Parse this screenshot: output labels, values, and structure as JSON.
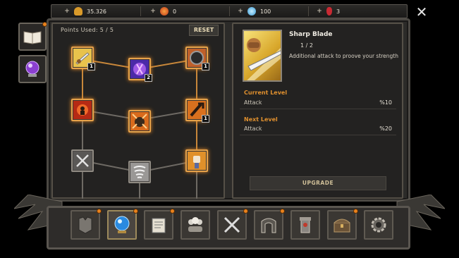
{
  "resources": [
    {
      "plus": "+",
      "value": "35.326",
      "icon": "gold-bag-icon",
      "color": "#e4a330"
    },
    {
      "plus": "+",
      "value": "0",
      "icon": "fire-orb-icon",
      "color": "#e4602a"
    },
    {
      "plus": "+",
      "value": "100",
      "icon": "blue-gem-icon",
      "color": "#6ec0e6"
    },
    {
      "plus": "+",
      "value": "3",
      "icon": "red-potion-icon",
      "color": "#d6343a"
    }
  ],
  "close_label": "✕",
  "side_tabs": [
    {
      "icon": "book-icon",
      "badge": true
    },
    {
      "icon": "crystal-ball-icon",
      "badge": false
    }
  ],
  "tree": {
    "points_label": "Points Used:",
    "points_value": "5 / 5",
    "reset_label": "RESET",
    "nodes": [
      {
        "icon": "sharp-blade-icon",
        "level": "1",
        "state": "active"
      },
      {
        "icon": "purple-aura-icon",
        "level": "2",
        "state": "active"
      },
      {
        "icon": "shield-icon",
        "level": "1",
        "state": "active"
      },
      {
        "icon": "warrior-fire-icon",
        "level": "",
        "state": "active"
      },
      {
        "icon": "fist-impact-icon",
        "level": "",
        "state": "active"
      },
      {
        "icon": "fire-sword-icon",
        "level": "1",
        "state": "active"
      },
      {
        "icon": "crossed-swords-icon",
        "level": "",
        "state": "inactive"
      },
      {
        "icon": "whirlwind-icon",
        "level": "",
        "state": "inactive"
      },
      {
        "icon": "raised-fist-icon",
        "level": "",
        "state": "active"
      }
    ]
  },
  "detail": {
    "title": "Sharp Blade",
    "rank": "1 / 2",
    "description": "Additional attack to proove your strength",
    "current_level_label": "Current Level",
    "current_stat_label": "Attack",
    "current_stat_value": "%10",
    "next_level_label": "Next Level",
    "next_stat_label": "Attack",
    "next_stat_value": "%20",
    "upgrade_label": "UPGRADE"
  },
  "dock": [
    {
      "icon": "armor-icon",
      "badge": true
    },
    {
      "icon": "crystal-orb-icon",
      "badge": true,
      "selected": true
    },
    {
      "icon": "scroll-icon",
      "badge": true
    },
    {
      "icon": "heroes-group-icon",
      "badge": false
    },
    {
      "icon": "crossed-swords-icon",
      "badge": true
    },
    {
      "icon": "gate-icon",
      "badge": true
    },
    {
      "icon": "tower-icon",
      "badge": false
    },
    {
      "icon": "treasure-chest-icon",
      "badge": true
    },
    {
      "icon": "gear-icon",
      "badge": false
    }
  ]
}
